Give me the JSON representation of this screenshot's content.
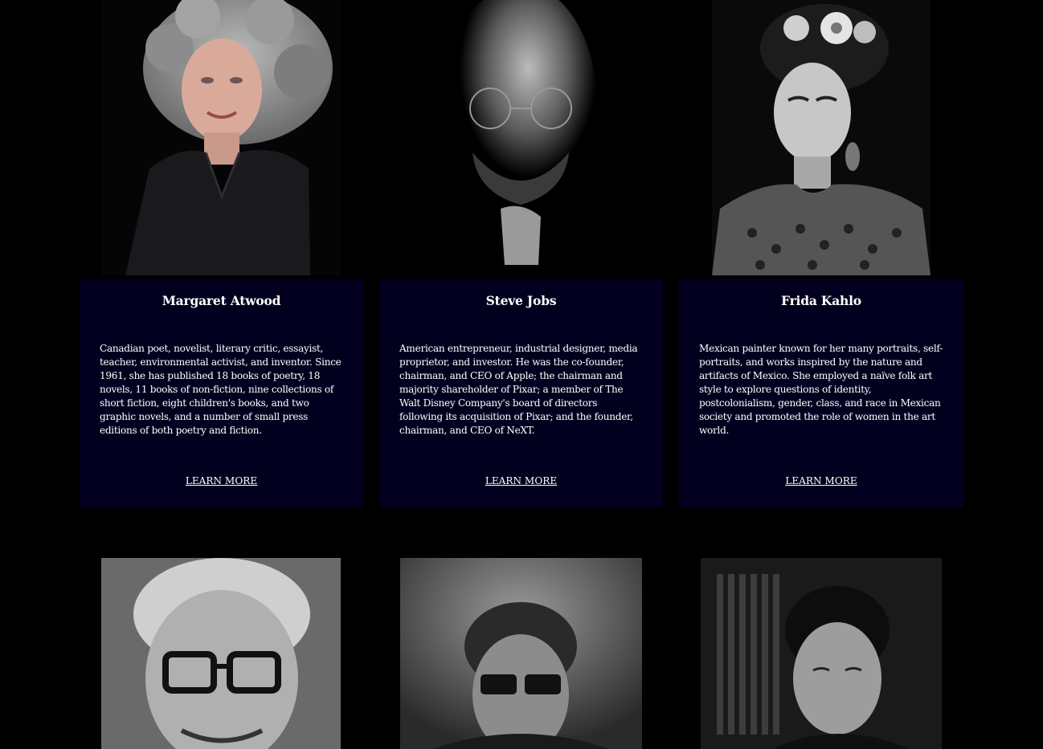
{
  "people": [
    {
      "name": "Margaret Atwood",
      "bio": "Canadian poet, novelist, literary critic, essayist, teacher, environmental activist, and inventor. Since 1961, she has published 18 books of poetry, 18 novels, 11 books of non-fiction, nine collections of short fiction, eight children's books, and two graphic novels, and a number of small press editions of both poetry and fiction.",
      "link": "LEARN MORE"
    },
    {
      "name": "Steve Jobs",
      "bio": "American entrepreneur, industrial designer, media proprietor, and investor. He was the co-founder, chairman, and CEO of Apple; the chairman and majority shareholder of Pixar; a member of The Walt Disney Company's board of directors following its acquisition of Pixar; and the founder, chairman, and CEO of NeXT.",
      "link": "LEARN MORE"
    },
    {
      "name": "Frida Kahlo",
      "bio": "Mexican painter known for her many portraits, self-portraits, and works inspired by the nature and artifacts of Mexico. She employed a naïve folk art style to explore questions of identity, postcolonialism, gender, class, and race in Mexican society and promoted the role of women in the art world.",
      "link": "LEARN MORE"
    }
  ],
  "colors": {
    "page_background": "#000000",
    "card_background": "#02001e",
    "text": "#ffffff"
  }
}
